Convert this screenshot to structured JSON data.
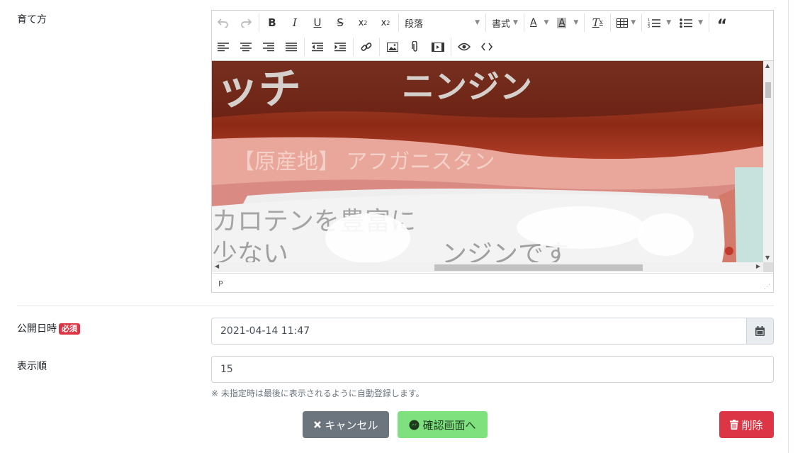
{
  "fields": {
    "cultivation_label": "育て方",
    "publish_label": "公開日時",
    "required_badge": "必須",
    "publish_value": "2021-04-14 11:47",
    "order_label": "表示順",
    "order_value": "15",
    "order_help": "※ 未指定時は最後に表示されるように自動登録します。"
  },
  "editor": {
    "paragraph_select": "段落",
    "format_dropdown": "書式",
    "status_path": "P",
    "image_text": {
      "line1a": "ッチ",
      "line1b": "ニンジン",
      "line2": "【原産地】 アフガニスタン",
      "line3": "カロテンを豊富に",
      "line4": "少ない　　　　　　ンジンです"
    },
    "toolbar_icons": [
      "undo-icon",
      "redo-icon",
      "bold-icon",
      "italic-icon",
      "underline-icon",
      "strikethrough-icon",
      "subscript-icon",
      "superscript-icon",
      "text-color-icon",
      "background-color-icon",
      "clear-format-icon",
      "table-icon",
      "ordered-list-icon",
      "unordered-list-icon",
      "blockquote-icon",
      "align-left-icon",
      "align-center-icon",
      "align-right-icon",
      "align-justify-icon",
      "outdent-icon",
      "indent-icon",
      "link-icon",
      "image-icon",
      "attachment-icon",
      "video-icon",
      "preview-icon",
      "code-view-icon"
    ]
  },
  "buttons": {
    "cancel": "キャンセル",
    "confirm": "確認画面へ",
    "delete": "削除"
  },
  "colors": {
    "danger": "#dc3545",
    "secondary": "#6c757d",
    "confirm": "#7ee17e"
  }
}
